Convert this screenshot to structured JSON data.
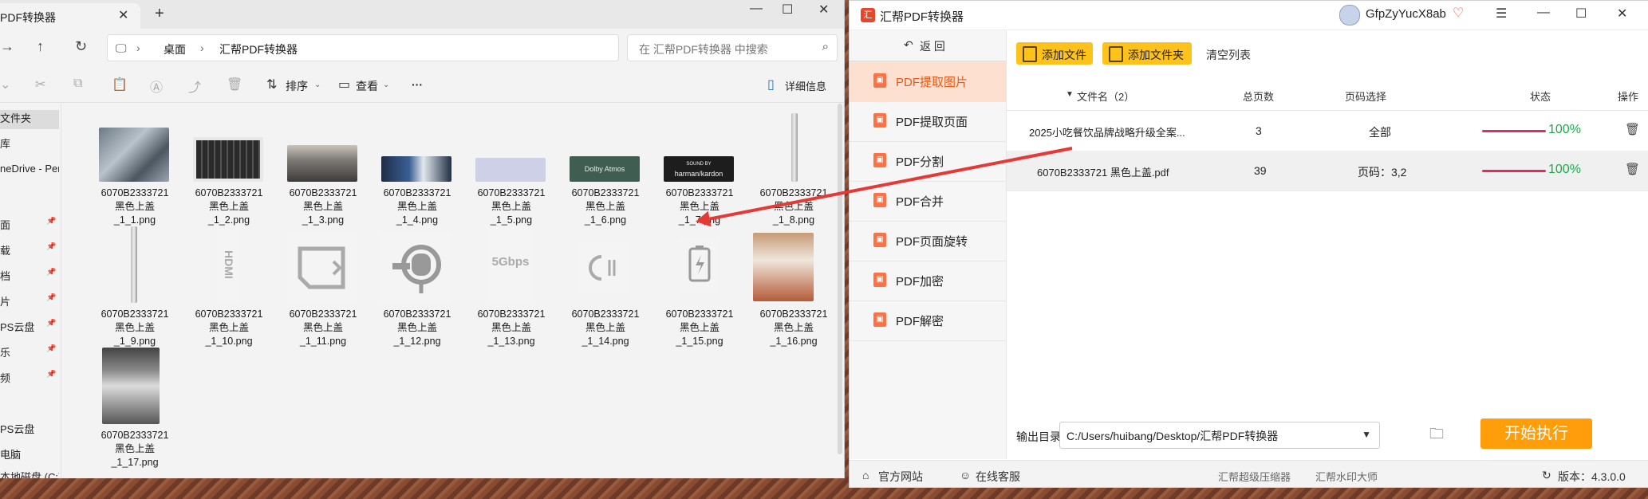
{
  "explorer": {
    "tab_title": "PDF转换器",
    "path": [
      "桌面",
      "汇帮PDF转换器"
    ],
    "search_placeholder": "在 汇帮PDF转换器 中搜索",
    "toolbar": {
      "sort": "排序",
      "view": "查看",
      "more": "···",
      "details": "详细信息"
    },
    "sidebar": [
      {
        "label": "文件夹",
        "selected": true
      },
      {
        "label": "库"
      },
      {
        "label": "neDrive - Per"
      },
      {
        "label": "面",
        "pinned": true
      },
      {
        "label": "载",
        "pinned": true
      },
      {
        "label": "档",
        "pinned": true
      },
      {
        "label": "片",
        "pinned": true
      },
      {
        "label": "PS云盘",
        "pinned": true
      },
      {
        "label": "乐",
        "pinned": true
      },
      {
        "label": "频",
        "pinned": true
      },
      {
        "label": "PS云盘"
      },
      {
        "label": "电脑"
      },
      {
        "label": "本地磁盘 (C:)"
      }
    ],
    "files": [
      {
        "l1": "6070B2333721",
        "l2": "黑色上盖",
        "l3": "_1_1.png"
      },
      {
        "l1": "6070B2333721",
        "l2": "黑色上盖",
        "l3": "_1_2.png"
      },
      {
        "l1": "6070B2333721",
        "l2": "黑色上盖",
        "l3": "_1_3.png"
      },
      {
        "l1": "6070B2333721",
        "l2": "黑色上盖",
        "l3": "_1_4.png"
      },
      {
        "l1": "6070B2333721",
        "l2": "黑色上盖",
        "l3": "_1_5.png"
      },
      {
        "l1": "6070B2333721",
        "l2": "黑色上盖",
        "l3": "_1_6.png"
      },
      {
        "l1": "6070B2333721",
        "l2": "黑色上盖",
        "l3": "_1_7.png"
      },
      {
        "l1": "6070B2333721",
        "l2": "黑色上盖",
        "l3": "_1_8.png"
      },
      {
        "l1": "6070B2333721",
        "l2": "黑色上盖",
        "l3": "_1_9.png"
      },
      {
        "l1": "6070B2333721",
        "l2": "黑色上盖",
        "l3": "_1_10.png"
      },
      {
        "l1": "6070B2333721",
        "l2": "黑色上盖",
        "l3": "_1_11.png"
      },
      {
        "l1": "6070B2333721",
        "l2": "黑色上盖",
        "l3": "_1_12.png"
      },
      {
        "l1": "6070B2333721",
        "l2": "黑色上盖",
        "l3": "_1_13.png"
      },
      {
        "l1": "6070B2333721",
        "l2": "黑色上盖",
        "l3": "_1_14.png"
      },
      {
        "l1": "6070B2333721",
        "l2": "黑色上盖",
        "l3": "_1_15.png"
      },
      {
        "l1": "6070B2333721",
        "l2": "黑色上盖",
        "l3": "_1_16.png"
      },
      {
        "l1": "6070B2333721",
        "l2": "黑色上盖",
        "l3": "_1_17.png"
      }
    ],
    "thumb_text": {
      "dolby": "Dolby Atmos",
      "harman_small": "SOUND BY",
      "harman": "harman/kardon",
      "hdmi": "HDMI",
      "gbps": "5Gbps"
    }
  },
  "app": {
    "title": "汇帮PDF转换器",
    "logo_text": "汇",
    "username": "GfpZyYucX8ab",
    "back_label": "返  回",
    "menu": [
      {
        "label": "PDF提取图片",
        "active": true
      },
      {
        "label": "PDF提取页面"
      },
      {
        "label": "PDF分割"
      },
      {
        "label": "PDF合并"
      },
      {
        "label": "PDF页面旋转"
      },
      {
        "label": "PDF加密"
      },
      {
        "label": "PDF解密"
      }
    ],
    "buttons": {
      "add_file": "添加文件",
      "add_folder": "添加文件夹",
      "clear": "清空列表"
    },
    "table": {
      "headers": {
        "name": "文件名（2）",
        "pages": "总页数",
        "page_sel": "页码选择",
        "status": "状态",
        "action": "操作"
      },
      "rows": [
        {
          "name": "2025小吃餐饮品牌战略升级全案...",
          "pages": "3",
          "page_sel": "全部",
          "progress": 100,
          "status": "100%"
        },
        {
          "name": "6070B2333721 黑色上盖.pdf",
          "pages": "39",
          "page_sel": "页码：3,2",
          "progress": 100,
          "status": "100%"
        }
      ]
    },
    "output": {
      "label": "输出目录:",
      "path": "C:/Users/huibang/Desktop/汇帮PDF转换器"
    },
    "start_button": "开始执行",
    "footer": {
      "website": "官方网站",
      "support": "在线客服",
      "compress": "汇帮超级压缩器",
      "watermark": "汇帮水印大师",
      "version": "版本：4.3.0.0"
    },
    "colors": {
      "accent": "#ffc21a",
      "start": "#ff9d0a",
      "active_menu": "#fde0cf",
      "progress": "#e12d5b",
      "status_text": "#1ea84b"
    }
  }
}
